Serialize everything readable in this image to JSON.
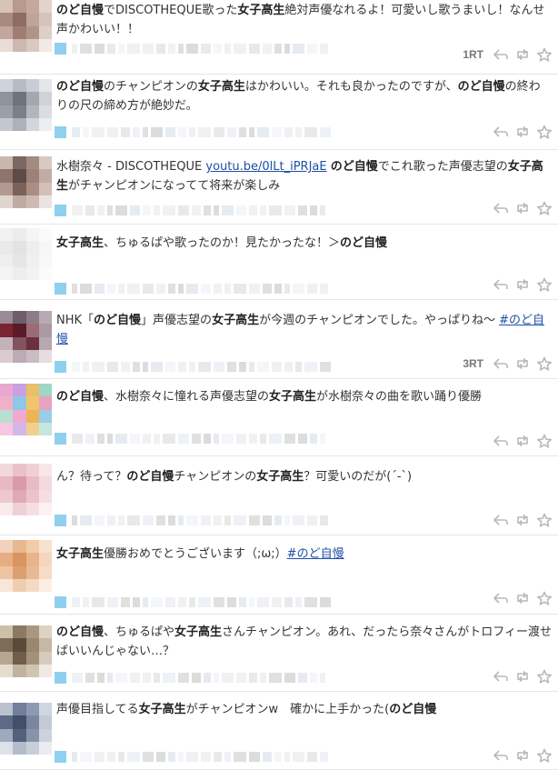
{
  "tweets": [
    {
      "segments": [
        {
          "t": "b",
          "v": "のど自慢"
        },
        {
          "t": "s",
          "v": "でDISCOTHEQUE歌った"
        },
        {
          "t": "b",
          "v": "女子高生"
        },
        {
          "t": "s",
          "v": "絶対声優なれるよ！可愛いし歌うまいし！なんせ声かわいい！！"
        }
      ],
      "rt": "1RT",
      "avatar": [
        "#d9c2b7",
        "#b89a8e",
        "#c7a89c",
        "#e3d3cb",
        "#a88a80",
        "#8e6c64",
        "#bda59b",
        "#d6c4bc",
        "#c4a79c",
        "#9e7e74",
        "#b09488",
        "#ddd0ca",
        "#e8ddd8",
        "#cdb8ae",
        "#d8c9c2",
        "#f0e9e6"
      ]
    },
    {
      "segments": [
        {
          "t": "b",
          "v": "のど自慢"
        },
        {
          "t": "s",
          "v": "のチャンピオンの"
        },
        {
          "t": "b",
          "v": "女子高生"
        },
        {
          "t": "s",
          "v": "はかわいい。それも良かったのですが、"
        },
        {
          "t": "b",
          "v": "のど自慢"
        },
        {
          "t": "s",
          "v": "の終わりの尺の締め方が絶妙だ。"
        }
      ],
      "rt": "",
      "avatar": [
        "#d0d4da",
        "#b7bcc4",
        "#c9ced5",
        "#e4e6ea",
        "#8f949c",
        "#6f747c",
        "#a3a8b0",
        "#cfd3d8",
        "#9aa0a8",
        "#7a8088",
        "#b2b7be",
        "#dadde1",
        "#c4c8ce",
        "#adb2b9",
        "#d2d5da",
        "#eceef0"
      ]
    },
    {
      "segments": [
        {
          "t": "s",
          "v": "水樹奈々 - DISCOTHEQUE "
        },
        {
          "t": "a",
          "v": "youtu.be/0lLt_iPRJaE"
        },
        {
          "t": "s",
          "v": " "
        },
        {
          "t": "b",
          "v": "のど自慢"
        },
        {
          "t": "s",
          "v": "でこれ歌った声優志望の"
        },
        {
          "t": "b",
          "v": "女子高生"
        },
        {
          "t": "s",
          "v": "がチャンピオンになってて将来が楽しみ"
        }
      ],
      "rt": "",
      "avatar": [
        "#c9b6ad",
        "#7d6660",
        "#a48b82",
        "#d8cac3",
        "#8f746c",
        "#5e4a46",
        "#9b8178",
        "#c2aca3",
        "#b39a91",
        "#7a625b",
        "#a88e85",
        "#d3c1b9",
        "#e1d5cf",
        "#c0aba2",
        "#cdbab2",
        "#ebe3df"
      ]
    },
    {
      "segments": [
        {
          "t": "b",
          "v": "女子高生"
        },
        {
          "t": "s",
          "v": "、ちゅるぱや歌ったのか！見たかったな！＞"
        },
        {
          "t": "b",
          "v": "のど自慢"
        }
      ],
      "rt": "",
      "avatar": [
        "#f2f2f2",
        "#ececec",
        "#f5f5f5",
        "#fafafa",
        "#e9e9e9",
        "#e3e3e3",
        "#eeeeee",
        "#f6f6f6",
        "#efefef",
        "#e6e6e6",
        "#f0f0f0",
        "#f8f8f8",
        "#f4f4f4",
        "#ededed",
        "#f3f3f3",
        "#fbfbfb"
      ]
    },
    {
      "segments": [
        {
          "t": "s",
          "v": "NHK「"
        },
        {
          "t": "b",
          "v": "のど自慢"
        },
        {
          "t": "s",
          "v": "」声優志望の"
        },
        {
          "t": "b",
          "v": "女子高生"
        },
        {
          "t": "s",
          "v": "が今週のチャンピオンでした。やっぱりね～ "
        },
        {
          "t": "a",
          "v": "#のど自慢"
        }
      ],
      "rt": "3RT",
      "avatar": [
        "#9a8a93",
        "#6e5e68",
        "#8d7b86",
        "#b8aab2",
        "#7a2434",
        "#5a1a28",
        "#9c6b78",
        "#a99aa3",
        "#c2b3bb",
        "#84525f",
        "#6b3040",
        "#b6a8b0",
        "#d8ccd2",
        "#bcaab4",
        "#cabcc3",
        "#e6dde1"
      ]
    },
    {
      "segments": [
        {
          "t": "b",
          "v": "のど自慢"
        },
        {
          "t": "s",
          "v": "、水樹奈々に憧れる声優志望の"
        },
        {
          "t": "b",
          "v": "女子高生"
        },
        {
          "t": "s",
          "v": "が水樹奈々の曲を歌い踊り優勝"
        }
      ],
      "rt": "",
      "avatar": [
        "#e7a9d3",
        "#c9a0e0",
        "#e6c06a",
        "#9fd7c5",
        "#f0b0c8",
        "#8ec7e8",
        "#f2c46e",
        "#e7a3c0",
        "#b8e0d0",
        "#f1a9d2",
        "#ecb456",
        "#9bcde8",
        "#f6c7e0",
        "#d2b8ea",
        "#f0d08a",
        "#c4e6dd"
      ]
    },
    {
      "segments": [
        {
          "t": "s",
          "v": "ん？待って？"
        },
        {
          "t": "b",
          "v": "のど自慢"
        },
        {
          "t": "s",
          "v": "チャンピオンの"
        },
        {
          "t": "b",
          "v": "女子高生"
        },
        {
          "t": "s",
          "v": "？可愛いのだが(´-`)"
        }
      ],
      "rt": "",
      "avatar": [
        "#f3d8dc",
        "#e9c3c9",
        "#f1cfd4",
        "#f8e6e8",
        "#eab8c2",
        "#d99aa6",
        "#e8bcc4",
        "#f4d9de",
        "#efc8cf",
        "#e0aab4",
        "#eec2ca",
        "#f6dfe3",
        "#f9eaec",
        "#f0d0d6",
        "#f5dde1",
        "#fcf1f3"
      ]
    },
    {
      "segments": [
        {
          "t": "b",
          "v": "女子高生"
        },
        {
          "t": "s",
          "v": "優勝おめでとうございます（;ω;）"
        },
        {
          "t": "a",
          "v": "#のど自慢"
        }
      ],
      "rt": "",
      "avatar": [
        "#f0d2bd",
        "#e8b890",
        "#f2cba8",
        "#f7e1cf",
        "#e6ad82",
        "#d9955f",
        "#e8b48a",
        "#f4d6bd",
        "#edc4a2",
        "#de9f70",
        "#e9b994",
        "#f6dcc6",
        "#f8e6d8",
        "#efcdb1",
        "#f4dac4",
        "#fbefe5"
      ]
    },
    {
      "segments": [
        {
          "t": "b",
          "v": "のど自慢"
        },
        {
          "t": "s",
          "v": "、ちゅるぱや"
        },
        {
          "t": "b",
          "v": "女子高生"
        },
        {
          "t": "s",
          "v": "さんチャンピオン。あれ、だったら奈々さんがトロフィー渡せばいいんじゃない…？"
        }
      ],
      "rt": "",
      "avatar": [
        "#cdbfa9",
        "#8b7a62",
        "#a99880",
        "#ddd2c3",
        "#7e6c56",
        "#5a4a3a",
        "#9a876f",
        "#c6b8a4",
        "#b7a691",
        "#6f5e4a",
        "#a49179",
        "#d6cbbc",
        "#e4dcd1",
        "#c2b39f",
        "#d0c4b3",
        "#eeeae3"
      ]
    },
    {
      "segments": [
        {
          "t": "s",
          "v": "声優目指してる"
        },
        {
          "t": "b",
          "v": "女子高生"
        },
        {
          "t": "s",
          "v": "がチャンピオンw　確かに上手かった("
        },
        {
          "t": "b",
          "v": "のど自慢"
        }
      ],
      "rt": "",
      "avatar": [
        "#b9c1cf",
        "#6f7f9c",
        "#8e9ab3",
        "#d0d6e0",
        "#5c6a86",
        "#444e66",
        "#7a86a0",
        "#c3cad6",
        "#9fa9bc",
        "#55607a",
        "#8893ab",
        "#cdd3dd",
        "#dde1e8",
        "#b3bccb",
        "#c9cfd9",
        "#e9ecf1"
      ]
    }
  ]
}
